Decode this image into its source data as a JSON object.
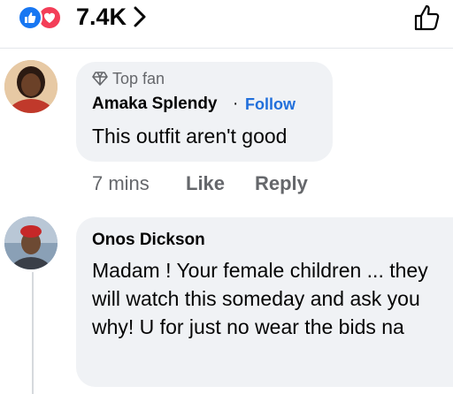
{
  "reactions": {
    "count": "7.4K",
    "icons": [
      "like-icon",
      "love-icon"
    ],
    "like_color": "#1877f2",
    "love_color": "#f33e58"
  },
  "comments": [
    {
      "badge": "Top fan",
      "author": "Amaka Splendy",
      "separator": "·",
      "follow_label": "Follow",
      "text": "This outfit aren't good",
      "time": "7 mins",
      "like_label": "Like",
      "reply_label": "Reply"
    },
    {
      "author": "Onos Dickson",
      "text": "Madam ! Your female children ... they will watch this someday and ask you why! U for just no wear the bids na"
    }
  ],
  "colors": {
    "bubble": "#f0f2f5",
    "link": "#216fdb",
    "secondary_text": "#65676b"
  }
}
